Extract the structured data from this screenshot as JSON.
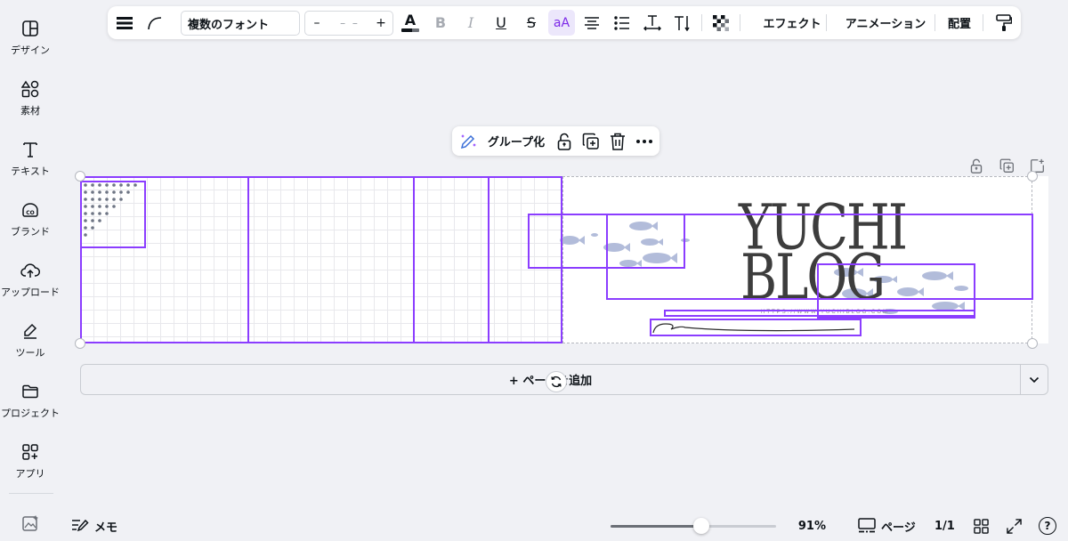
{
  "sidebar": {
    "items": [
      {
        "label": "デザイン",
        "icon": "layout-icon"
      },
      {
        "label": "素材",
        "icon": "shapes-icon"
      },
      {
        "label": "テキスト",
        "icon": "text-icon"
      },
      {
        "label": "ブランド",
        "icon": "brand-icon"
      },
      {
        "label": "アップロード",
        "icon": "upload-cloud-icon"
      },
      {
        "label": "ツール",
        "icon": "pen-tool-icon"
      },
      {
        "label": "プロジェクト",
        "icon": "folder-icon"
      },
      {
        "label": "アプリ",
        "icon": "apps-icon"
      }
    ]
  },
  "toolbar": {
    "font_name": "複数のフォント",
    "font_size_minus": "–",
    "font_size_value": "– –",
    "font_size_plus": "+",
    "text_color_glyph": "A",
    "bold_glyph": "B",
    "italic_glyph": "I",
    "underline_glyph": "U",
    "strike_glyph": "S",
    "case_glyph": "aA",
    "effects_label": "エフェクト",
    "animation_label": "アニメーション",
    "position_label": "配置"
  },
  "context_menu": {
    "group_label": "グループ化"
  },
  "canvas": {
    "logo_line1": "YUCHI",
    "logo_line2": "BLOG",
    "url_text": "HTTPS://WWW.YUCHIBLOG.COM"
  },
  "add_page_label": "+ ページを追加",
  "bottom_bar": {
    "notes_label": "メモ",
    "zoom_level": "91%",
    "zoom_fraction": 0.55,
    "pages_label": "ページ",
    "page_counter": "1/1",
    "help_glyph": "?"
  },
  "colors": {
    "accent": "#8b3dff",
    "background": "#f0f1f5",
    "text": "#0e1318"
  }
}
